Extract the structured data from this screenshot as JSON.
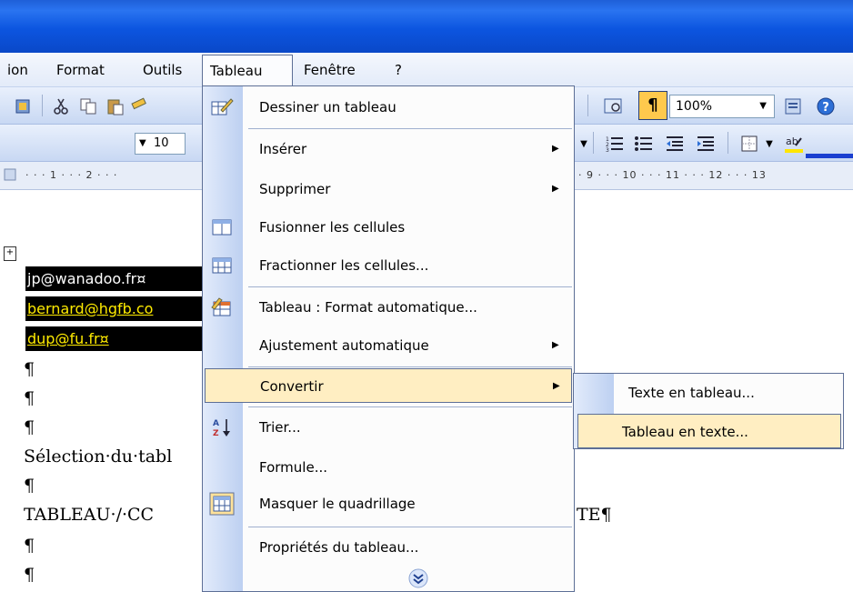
{
  "menubar": {
    "items": [
      {
        "label": "ion"
      },
      {
        "label": "Format"
      },
      {
        "label": "Outils"
      },
      {
        "label": "Tableau"
      },
      {
        "label": "Fenêtre"
      },
      {
        "label": "?"
      }
    ]
  },
  "toolbar": {
    "font_size": "10",
    "zoom": "100%",
    "paragraph_mark": "¶"
  },
  "ruler": {
    "left": "· · · 1 · · · 2 · · ·",
    "right": "· 9 · · · 10 · · · 11 · · · 12 · · · 13"
  },
  "document": {
    "cells": [
      "jp@wanadoo.fr¤",
      "bernard@hgfb.co",
      "dup@fu.fr¤"
    ],
    "para": "¶",
    "line1": "Sélection·du·tabl",
    "line2": "TABLEAU·/·CC",
    "line2_tail": "TE¶",
    "table_handle": "+"
  },
  "menu": {
    "items": [
      {
        "label": "Dessiner un tableau",
        "icon": "pencil-table-icon"
      },
      {
        "label": "Insérer",
        "submenu": true
      },
      {
        "label": "Supprimer",
        "submenu": true
      },
      {
        "label": "Fusionner les cellules",
        "icon": "merge-cells-icon"
      },
      {
        "label": "Fractionner les cellules...",
        "icon": "split-cells-icon"
      },
      {
        "label": "Tableau : Format automatique...",
        "icon": "autoformat-icon"
      },
      {
        "label": "Ajustement automatique",
        "submenu": true
      },
      {
        "label": "Convertir",
        "submenu": true
      },
      {
        "label": "Trier...",
        "icon": "sort-az-icon"
      },
      {
        "label": "Formule..."
      },
      {
        "label": "Masquer le quadrillage",
        "icon": "gridlines-icon"
      },
      {
        "label": "Propriétés du tableau..."
      }
    ],
    "expand_icon": "chevron-double-down-icon"
  },
  "submenu": {
    "items": [
      {
        "label": "Texte en tableau..."
      },
      {
        "label": "Tableau en texte..."
      }
    ]
  },
  "colors": {
    "titlebar": "#0a48c8",
    "highlight": "#ffeec2",
    "border": "#5d6f96",
    "gutter": "#bdd0f1"
  }
}
